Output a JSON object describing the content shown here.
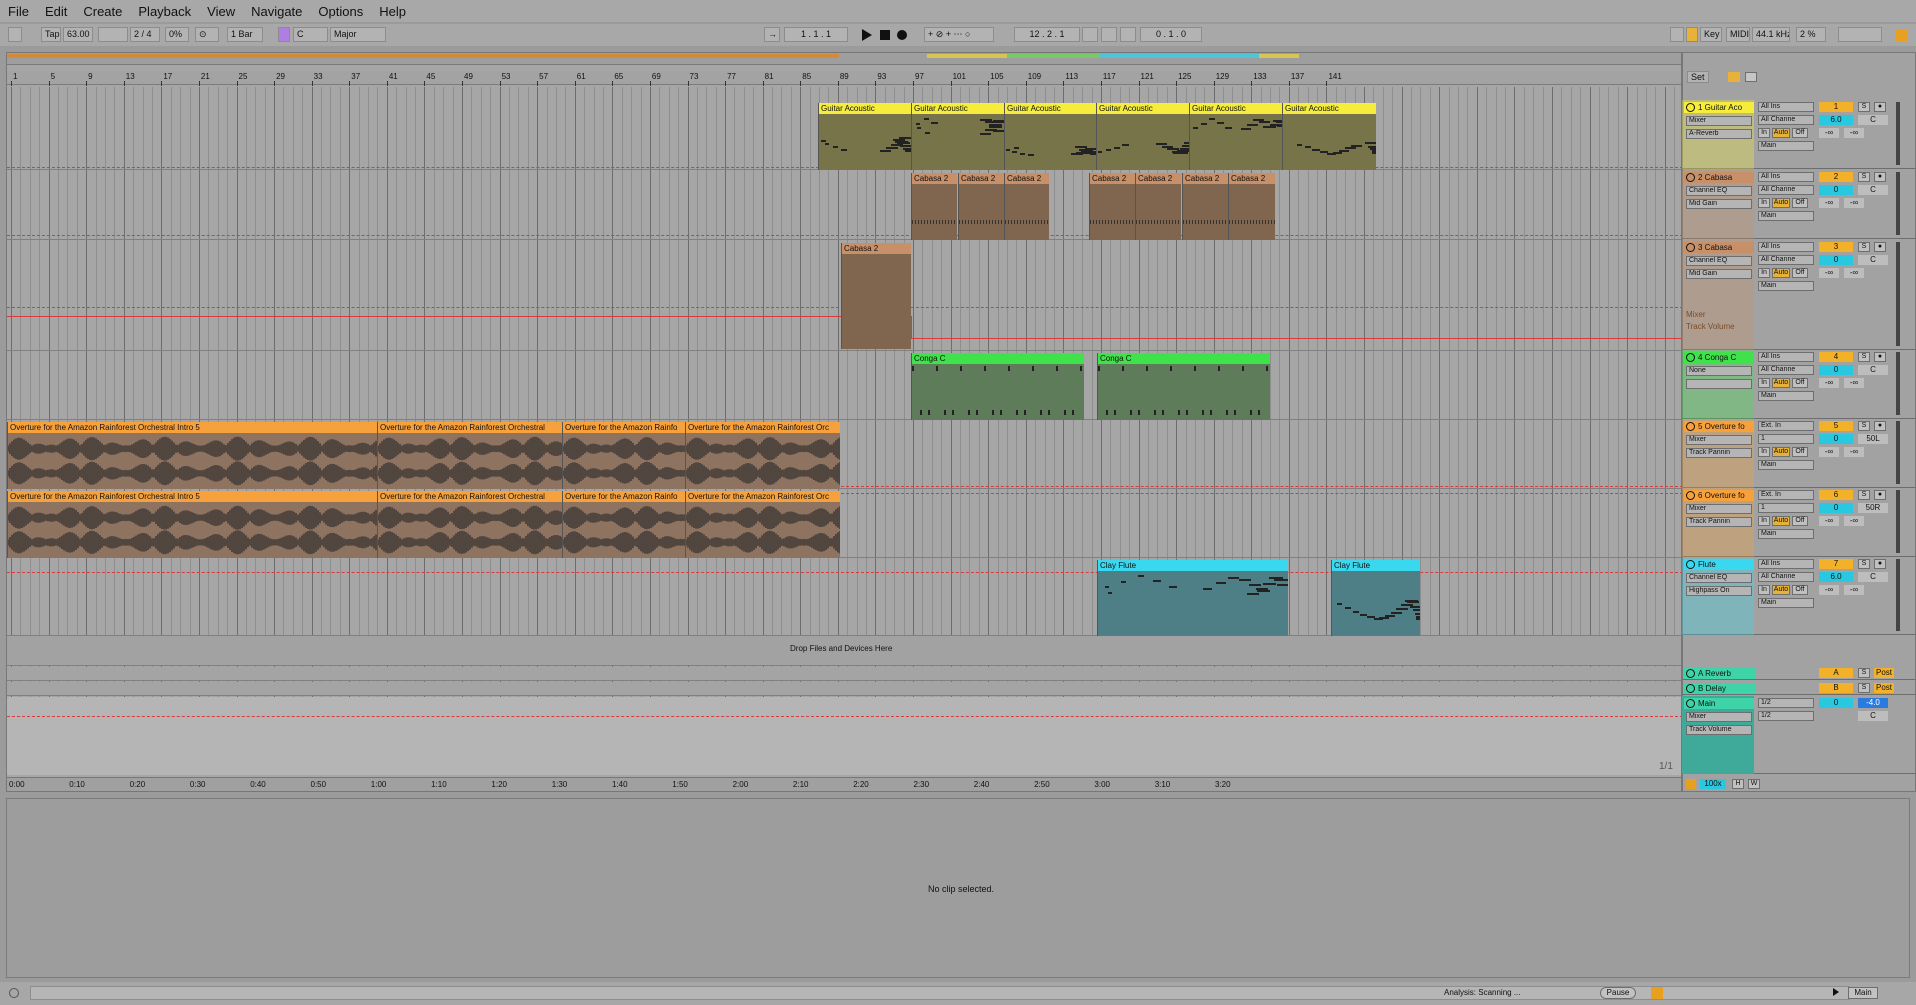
{
  "menu": [
    "File",
    "Edit",
    "Create",
    "Playback",
    "View",
    "Navigate",
    "Options",
    "Help"
  ],
  "toolbar": {
    "tap": "Tap",
    "tempo": "63.00",
    "signature": "2 / 4",
    "groove": "0%",
    "quantize": "1 Bar",
    "key_root": "C",
    "scale": "Major",
    "position": "1 . 1 . 1",
    "loop_start": "12 . 2 . 1",
    "loop_length": "0 . 1 . 0",
    "key_label": "Key",
    "midi_label": "MIDI",
    "sample_rate": "44.1 kHz",
    "cpu": "2 %"
  },
  "ruler_bars": [
    "1",
    "5",
    "9",
    "13",
    "17",
    "21",
    "25",
    "29",
    "33",
    "37",
    "41",
    "45",
    "49",
    "53",
    "57",
    "61",
    "65",
    "69",
    "73",
    "77",
    "81",
    "85",
    "89",
    "93",
    "97",
    "101",
    "105",
    "109",
    "113",
    "117",
    "121",
    "125",
    "129",
    "133",
    "137",
    "141"
  ],
  "time_labels": [
    "0:00",
    "0:10",
    "0:20",
    "0:30",
    "0:40",
    "0:50",
    "1:00",
    "1:10",
    "1:20",
    "1:30",
    "1:40",
    "1:50",
    "2:00",
    "2:10",
    "2:20",
    "2:30",
    "2:40",
    "2:50",
    "3:00",
    "3:10",
    "3:20"
  ],
  "set_button": "Set",
  "tracks": [
    {
      "name": "1 Guitar Aco",
      "number": "1",
      "color": "#f5ec3b",
      "device": "Mixer",
      "sub": "A-Reverb",
      "input": "All Ins",
      "channel": "All Channe",
      "monitor_in": "In",
      "monitor_auto": "Auto",
      "monitor_off": "Off",
      "output": "Main",
      "volume": "6.0",
      "pan": "C",
      "sends": [
        "-∞",
        "-∞"
      ]
    },
    {
      "name": "2 Cabasa",
      "number": "2",
      "color": "#c79068",
      "device": "Channel EQ",
      "sub": "Mid Gain",
      "input": "All Ins",
      "channel": "All Channe",
      "monitor_in": "In",
      "monitor_auto": "Auto",
      "monitor_off": "Off",
      "output": "Main",
      "volume": "0",
      "pan": "C",
      "sends": [
        "-∞",
        "-∞"
      ]
    },
    {
      "name": "3 Cabasa",
      "number": "3",
      "color": "#c79068",
      "device": "Channel EQ",
      "sub": "Mid Gain",
      "input": "All Ins",
      "channel": "All Channe",
      "monitor_in": "In",
      "monitor_auto": "Auto",
      "monitor_off": "Off",
      "output": "Main",
      "volume": "0",
      "pan": "C",
      "sends": [
        "-∞",
        "-∞"
      ],
      "auto_device": "Mixer",
      "auto_param": "Track Volume"
    },
    {
      "name": "4 Conga C",
      "number": "4",
      "color": "#3fe24a",
      "device": "None",
      "sub": "",
      "input": "All Ins",
      "channel": "All Channe",
      "monitor_in": "In",
      "monitor_auto": "Auto",
      "monitor_off": "Off",
      "output": "Main",
      "volume": "0",
      "pan": "C",
      "sends": [
        "-∞",
        "-∞"
      ]
    },
    {
      "name": "5 Overture fo",
      "number": "5",
      "color": "#f7a13d",
      "device": "Mixer",
      "sub": "Track Pannin",
      "input": "Ext. In",
      "channel": "1",
      "monitor_in": "In",
      "monitor_auto": "Auto",
      "monitor_off": "Off",
      "output": "Main",
      "volume": "0",
      "pan": "50L",
      "sends": [
        "-∞",
        "-∞"
      ]
    },
    {
      "name": "6 Overture fo",
      "number": "6",
      "color": "#f7a13d",
      "device": "Mixer",
      "sub": "Track Pannin",
      "input": "Ext. In",
      "channel": "1",
      "monitor_in": "In",
      "monitor_auto": "Auto",
      "monitor_off": "Off",
      "output": "Main",
      "volume": "0",
      "pan": "50R",
      "sends": [
        "-∞",
        "-∞"
      ]
    },
    {
      "name": "Flute",
      "number": "7",
      "color": "#39d8ee",
      "device": "Channel EQ",
      "sub": "Highpass On",
      "input": "All Ins",
      "channel": "All Channe",
      "monitor_in": "In",
      "monitor_auto": "Auto",
      "monitor_off": "Off",
      "output": "Main",
      "volume": "6.0",
      "pan": "C",
      "sends": [
        "-∞",
        "-∞"
      ]
    }
  ],
  "clips": {
    "guitar": "Guitar Acoustic",
    "cabasa": "Cabasa 2",
    "conga": "Conga C",
    "overture_full": "Overture for the Amazon Rainforest Orchestral Intro 5",
    "overture_mid": "Overture for the Amazon Rainforest Orchestral",
    "overture_short": "Overture for the Amazon Rainfo",
    "overture_end": "Overture for the Amazon Rainforest Orc",
    "flute": "Clay Flute"
  },
  "drop_hint": "Drop Files and Devices Here",
  "returns": [
    {
      "name": "A Reverb",
      "letter": "A",
      "color": "#3fd4a8",
      "send_mode": "Post"
    },
    {
      "name": "B Delay",
      "letter": "B",
      "color": "#3fd4a8",
      "send_mode": "Post"
    }
  ],
  "main": {
    "name": "Main",
    "device": "Mixer",
    "param": "Track Volume",
    "out1": "1/2",
    "out2": "1/2",
    "volume": "0",
    "pan": "C",
    "level": "-4.0"
  },
  "page_indicator": "1/1",
  "zoom": "100x",
  "detail_message": "No clip selected.",
  "status": {
    "analysis": "Analysis: Scanning ...",
    "pause": "Pause",
    "main": "Main"
  },
  "colors": {
    "guitar": "#f5ec3b",
    "cabasa": "#c79068",
    "conga": "#3fe24a",
    "overture": "#f7a13d",
    "flute": "#39d8ee",
    "return": "#3fd4a8",
    "main": "#3fd4a8"
  }
}
